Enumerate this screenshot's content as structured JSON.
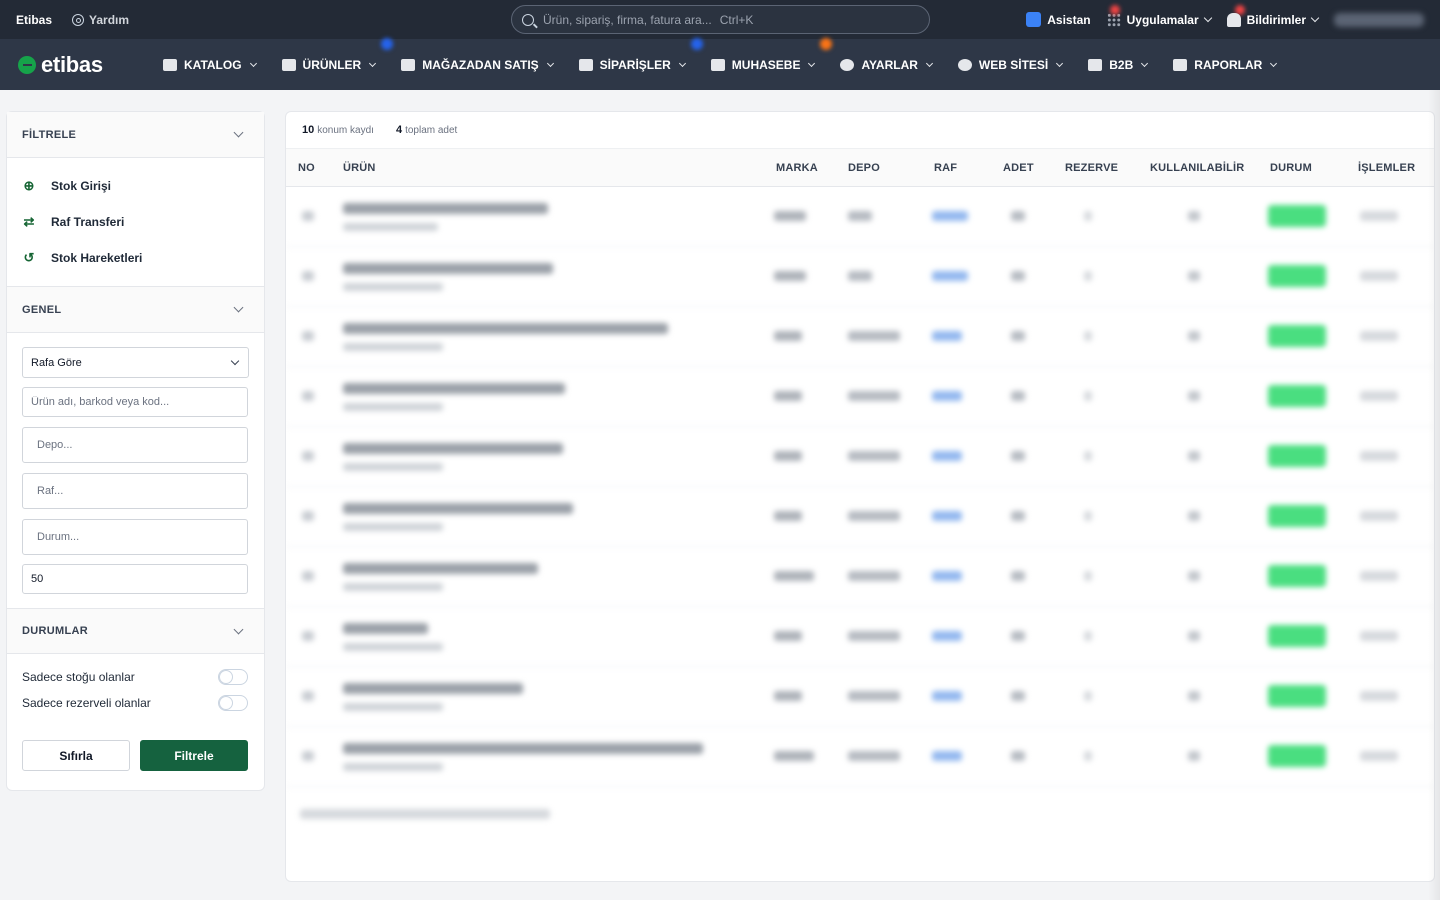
{
  "topbar": {
    "brand": "Etibas",
    "help": "Yardım",
    "search_placeholder": "Ürün, sipariş, firma, fatura ara...",
    "search_shortcut": "Ctrl+K",
    "assistant": "Asistan",
    "apps": "Uygulamalar",
    "notifications": "Bildirimler"
  },
  "nav": {
    "logo": "etibas",
    "items": [
      {
        "label": "KATALOG",
        "icon": "catalog-icon"
      },
      {
        "label": "ÜRÜNLER",
        "icon": "tag-icon",
        "badge_color": "#2563eb"
      },
      {
        "label": "MAĞAZADAN SATIŞ",
        "icon": "store-icon"
      },
      {
        "label": "SİPARİŞLER",
        "icon": "cart-icon",
        "badge_color": "#2563eb"
      },
      {
        "label": "MUHASEBE",
        "icon": "calculator-icon",
        "badge_color": "#f97316"
      },
      {
        "label": "AYARLAR",
        "icon": "gear-icon"
      },
      {
        "label": "WEB SİTESİ",
        "icon": "globe-icon"
      },
      {
        "label": "B2B",
        "icon": "shop-icon"
      },
      {
        "label": "RAPORLAR",
        "icon": "report-icon"
      }
    ]
  },
  "sidebar": {
    "filter_title": "FİLTRELE",
    "actions": [
      {
        "label": "Stok Girişi",
        "icon": "plus-circle-icon"
      },
      {
        "label": "Raf Transferi",
        "icon": "transfer-icon"
      },
      {
        "label": "Stok Hareketleri",
        "icon": "history-icon"
      }
    ],
    "general_title": "GENEL",
    "group_select": "Rafa Göre",
    "search_placeholder": "Ürün adı, barkod veya kod...",
    "depo_placeholder": "Depo...",
    "raf_placeholder": "Raf...",
    "durum_placeholder": "Durum...",
    "limit_value": "50",
    "status_title": "DURUMLAR",
    "toggle_stock": "Sadece stoğu olanlar",
    "toggle_reserved": "Sadece rezerveli olanlar",
    "reset": "Sıfırla",
    "apply": "Filtrele"
  },
  "main": {
    "summary_count_value": "10",
    "summary_count_label": "konum kaydı",
    "summary_total_value": "4",
    "summary_total_label": "toplam adet",
    "columns": [
      "NO",
      "ÜRÜN",
      "MARKA",
      "DEPO",
      "RAF",
      "ADET",
      "REZERVE",
      "KULLANILABİLİR",
      "DURUM",
      "İŞLEMLER"
    ],
    "status_color": "#4ade80"
  }
}
